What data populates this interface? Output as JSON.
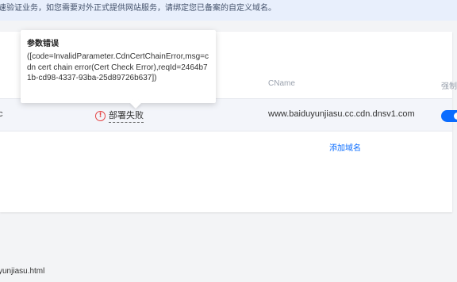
{
  "notice": {
    "text": "速验证业务，如您需要对外正式提供网站服务，请绑定您已备案的自定义域名。"
  },
  "table": {
    "columns": {
      "cname": "CName",
      "force": "强制"
    },
    "rows": [
      {
        "domain_tail": "c",
        "status_text": "部署失败",
        "cname": "www.baiduyunjiasu.cc.cdn.dnsv1.com",
        "force_enabled": true
      }
    ],
    "add_domain_label": "添加域名"
  },
  "tooltip": {
    "title": "参数错误",
    "body": "([code=InvalidParameter.CdnCertChainError,msg=cdn cert chain error(Cert Check Error),reqId=2464b71b-cd98-4337-93ba-25d89726b637])"
  },
  "bottom": {
    "text": "yunjiasu.html"
  },
  "colors": {
    "accent": "#0a6cff",
    "error": "#e54545",
    "notice_bg": "#e8effc"
  }
}
